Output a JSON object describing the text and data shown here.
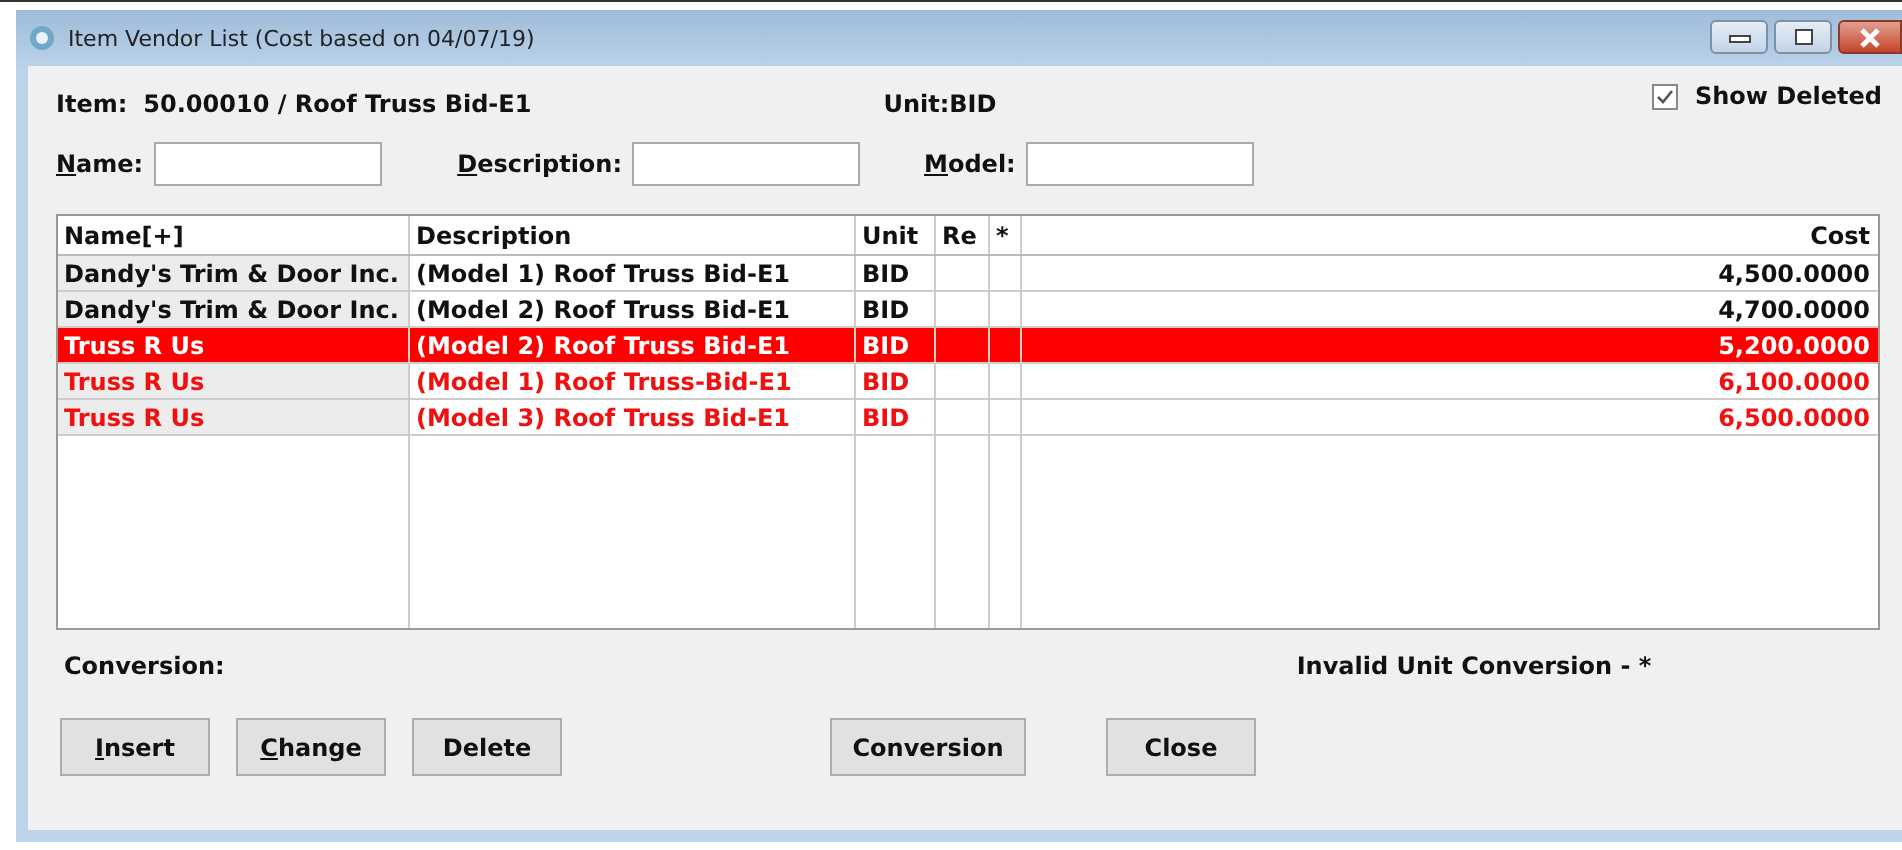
{
  "window": {
    "title": "Item Vendor List (Cost based on 04/07/19)"
  },
  "item_label": "Item:",
  "item_value": "50.00010 / Roof Truss Bid-E1",
  "unit_label": "Unit:BID",
  "show_deleted": {
    "label": "Show Deleted",
    "checked": true
  },
  "filters": [
    {
      "label": "Name:",
      "mnemonic": true
    },
    {
      "label": "Description:",
      "mnemonic": true
    },
    {
      "label": "Model:",
      "mnemonic": true
    }
  ],
  "table": {
    "columns": [
      "Name[+]",
      "Description",
      "Unit",
      "Re",
      "*",
      "Cost"
    ],
    "rows": [
      {
        "cells": [
          "Dandy's Trim & Door Inc.",
          "(Model 1) Roof Truss Bid-E1",
          "BID",
          "",
          "",
          "4,500.0000"
        ],
        "selected": false,
        "flagged": false
      },
      {
        "cells": [
          "Dandy's Trim & Door Inc.",
          "(Model 2) Roof Truss Bid-E1",
          "BID",
          "",
          "",
          "4,700.0000"
        ],
        "selected": false,
        "flagged": false
      },
      {
        "cells": [
          "Truss R Us",
          "(Model 2) Roof Truss Bid-E1",
          "BID",
          "",
          "",
          "5,200.0000"
        ],
        "selected": true,
        "flagged": true
      },
      {
        "cells": [
          "Truss R Us",
          "(Model 1) Roof Truss-Bid-E1",
          "BID",
          "",
          "",
          "6,100.0000"
        ],
        "selected": false,
        "flagged": true
      },
      {
        "cells": [
          "Truss R Us",
          "(Model 3) Roof Truss Bid-E1",
          "BID",
          "",
          "",
          "6,500.0000"
        ],
        "selected": false,
        "flagged": true
      }
    ]
  },
  "conversion_label": "Conversion:",
  "invalid_note": "Invalid Unit Conversion - *",
  "buttons": [
    {
      "label": "Insert",
      "mnemonic": true
    },
    {
      "label": "Change",
      "mnemonic": true
    },
    {
      "label": "Delete",
      "mnemonic": false
    },
    {
      "label": "Conversion",
      "mnemonic": false
    },
    {
      "label": "Close",
      "mnemonic": false
    }
  ]
}
